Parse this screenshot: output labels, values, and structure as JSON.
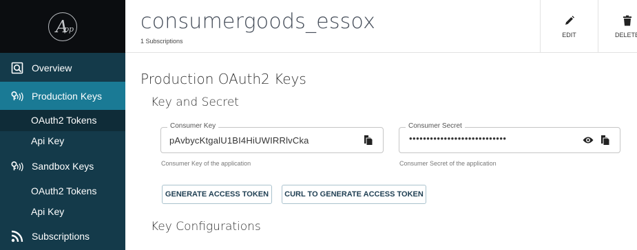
{
  "sidebar": {
    "items": [
      {
        "label": "Overview",
        "icon": "overview-icon"
      },
      {
        "label": "Production Keys",
        "icon": "key-icon"
      },
      {
        "label": "OAuth2 Tokens"
      },
      {
        "label": "Api Key"
      },
      {
        "label": "Sandbox Keys",
        "icon": "key-icon"
      },
      {
        "label": "OAuth2 Tokens"
      },
      {
        "label": "Api Key"
      },
      {
        "label": "Subscriptions",
        "icon": "subscriptions-icon"
      }
    ],
    "active_item": "Production Keys",
    "colors": {
      "background": "#143a4a",
      "active": "#1a7a95",
      "logo_bg": "#0b0d10"
    }
  },
  "header": {
    "title": "consumergoods_essox",
    "subtitle": "1 Subscriptions",
    "edit_label": "EDIT",
    "delete_label": "DELETE"
  },
  "main": {
    "heading": "Production OAuth2 Keys",
    "key_secret_heading": "Key and Secret",
    "consumer_key": {
      "label": "Consumer Key",
      "value": "pAvbycKtgalU1BI4HiUWIRRlvCka",
      "helper": "Consumer Key of the application"
    },
    "consumer_secret": {
      "label": "Consumer Secret",
      "value": "••••••••••••••••••••••••••••",
      "helper": "Consumer Secret of the application"
    },
    "generate_button": "GENERATE ACCESS TOKEN",
    "curl_button": "CURL TO GENERATE ACCESS TOKEN",
    "key_config_heading": "Key Configurations"
  }
}
